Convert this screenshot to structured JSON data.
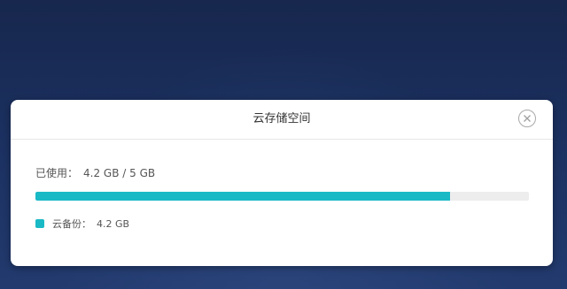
{
  "dialog": {
    "title": "云存储空间"
  },
  "usage": {
    "used_label": "已使用：",
    "used_value": "4.2 GB / 5 GB",
    "progress_fraction": 0.84,
    "progress_color": "#1ab9c6",
    "track_color": "#ededed"
  },
  "legend": {
    "label": "云备份：",
    "value": "4.2 GB",
    "color": "#1ab9c6"
  },
  "icons": {
    "close": "close-circle-icon"
  }
}
